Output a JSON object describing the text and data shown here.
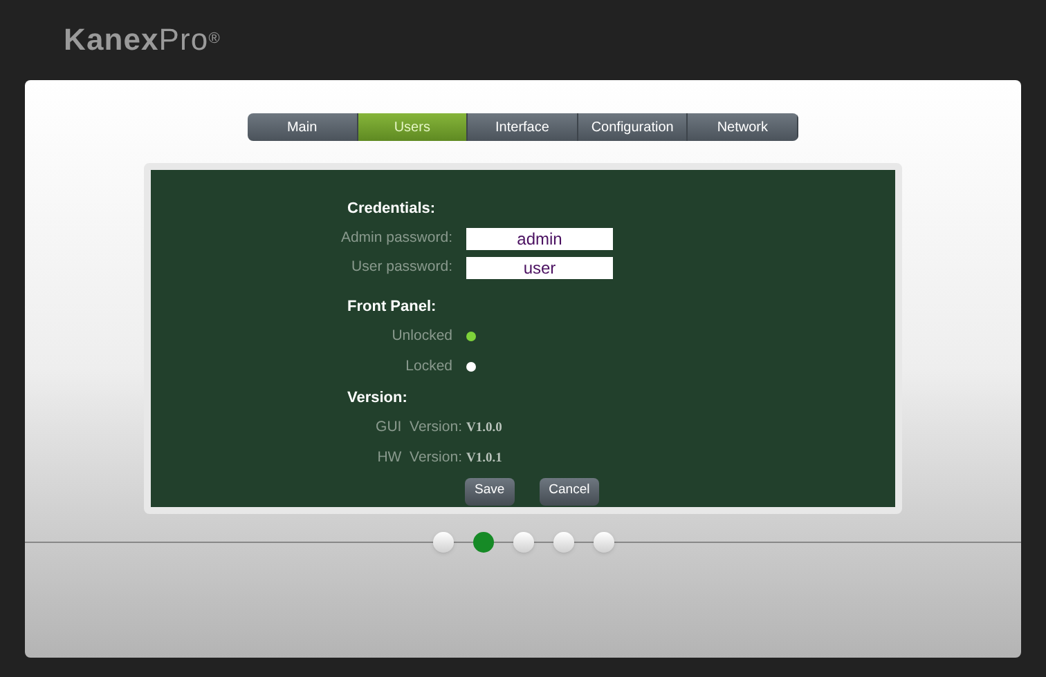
{
  "logo": {
    "bold": "Kanex",
    "light": "Pro",
    "mark": "®"
  },
  "tabs": [
    {
      "label": "Main",
      "selected": false
    },
    {
      "label": "Users",
      "selected": true
    },
    {
      "label": "Interface",
      "selected": false
    },
    {
      "label": "Configuration",
      "selected": false
    },
    {
      "label": "Network",
      "selected": false
    }
  ],
  "credentials": {
    "heading": "Credentials:",
    "fields": [
      {
        "label": "Admin password:",
        "value": "admin"
      },
      {
        "label": "User password:",
        "value": "user"
      }
    ]
  },
  "front_panel": {
    "heading": "Front Panel:",
    "options": [
      {
        "label": "Unlocked",
        "selected": true
      },
      {
        "label": "Locked",
        "selected": false
      }
    ]
  },
  "version": {
    "heading": "Version:",
    "rows": [
      {
        "label": "GUI  Version:",
        "value": "V1.0.0"
      },
      {
        "label": "HW  Version:",
        "value": "V1.0.1"
      }
    ]
  },
  "buttons": [
    "Save",
    "Cancel"
  ],
  "pages": [
    {
      "selected": false
    },
    {
      "selected": true
    },
    {
      "selected": false
    },
    {
      "selected": false
    },
    {
      "selected": false
    }
  ]
}
